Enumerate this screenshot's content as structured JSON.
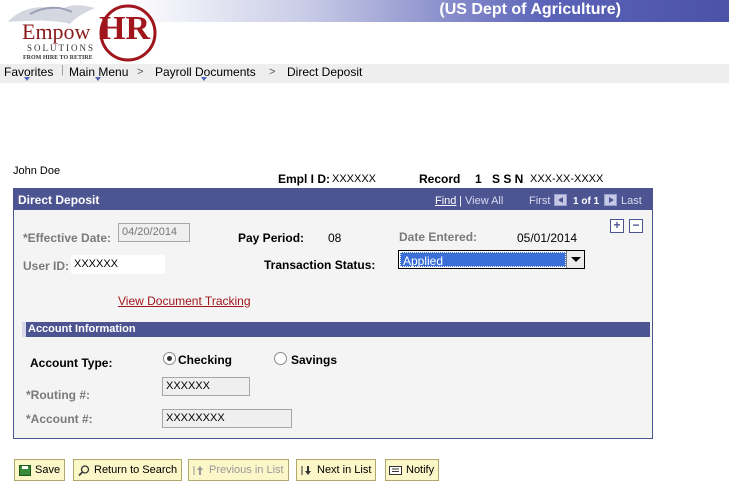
{
  "header": {
    "logo_text_1": "Empow",
    "logo_text_2": "HR",
    "logo_text_3": "SOLUTIONS",
    "logo_text_4": "FROM HIRE TO RETIRE",
    "title": "(US Dept of Agriculture)"
  },
  "nav": {
    "items": [
      "Favorites",
      "Main Menu",
      "Payroll Documents",
      "Direct Deposit"
    ],
    "separator": ">"
  },
  "person": {
    "name": "John Doe",
    "empl_id_label": "Empl I D:",
    "empl_id_value": "XXXXXX",
    "record_label": "Record",
    "record_value": "1",
    "ssn_label": "S S N",
    "ssn_value": "XXX-XX-XXXX"
  },
  "panel": {
    "title": "Direct Deposit",
    "find": "Find",
    "view_all": "View All",
    "first": "First",
    "count": "1 of 1",
    "last": "Last",
    "plus": "+",
    "minus": "−",
    "effective_date_label": "*Effective Date:",
    "effective_date_value": "04/20/2014",
    "pay_period_label": "Pay Period:",
    "pay_period_value": "08",
    "date_entered_label": "Date Entered:",
    "date_entered_value": "05/01/2014",
    "user_id_label": "User ID:",
    "user_id_value": "XXXXXX",
    "transaction_status_label": "Transaction Status:",
    "transaction_status_value": "Applied",
    "view_doc_tracking": "View Document Tracking",
    "account_info_title": "Account Information",
    "account_type_label": "Account Type:",
    "checking_label": "Checking",
    "savings_label": "Savings",
    "account_type_selected": "Checking",
    "routing_label": "*Routing #:",
    "routing_value": "XXXXXX",
    "account_label": "*Account #:",
    "account_value": "XXXXXXXX"
  },
  "toolbar": {
    "save": "Save",
    "return_to_search": "Return to Search",
    "previous_in_list": "Previous in List",
    "next_in_list": "Next in List",
    "notify": "Notify"
  }
}
